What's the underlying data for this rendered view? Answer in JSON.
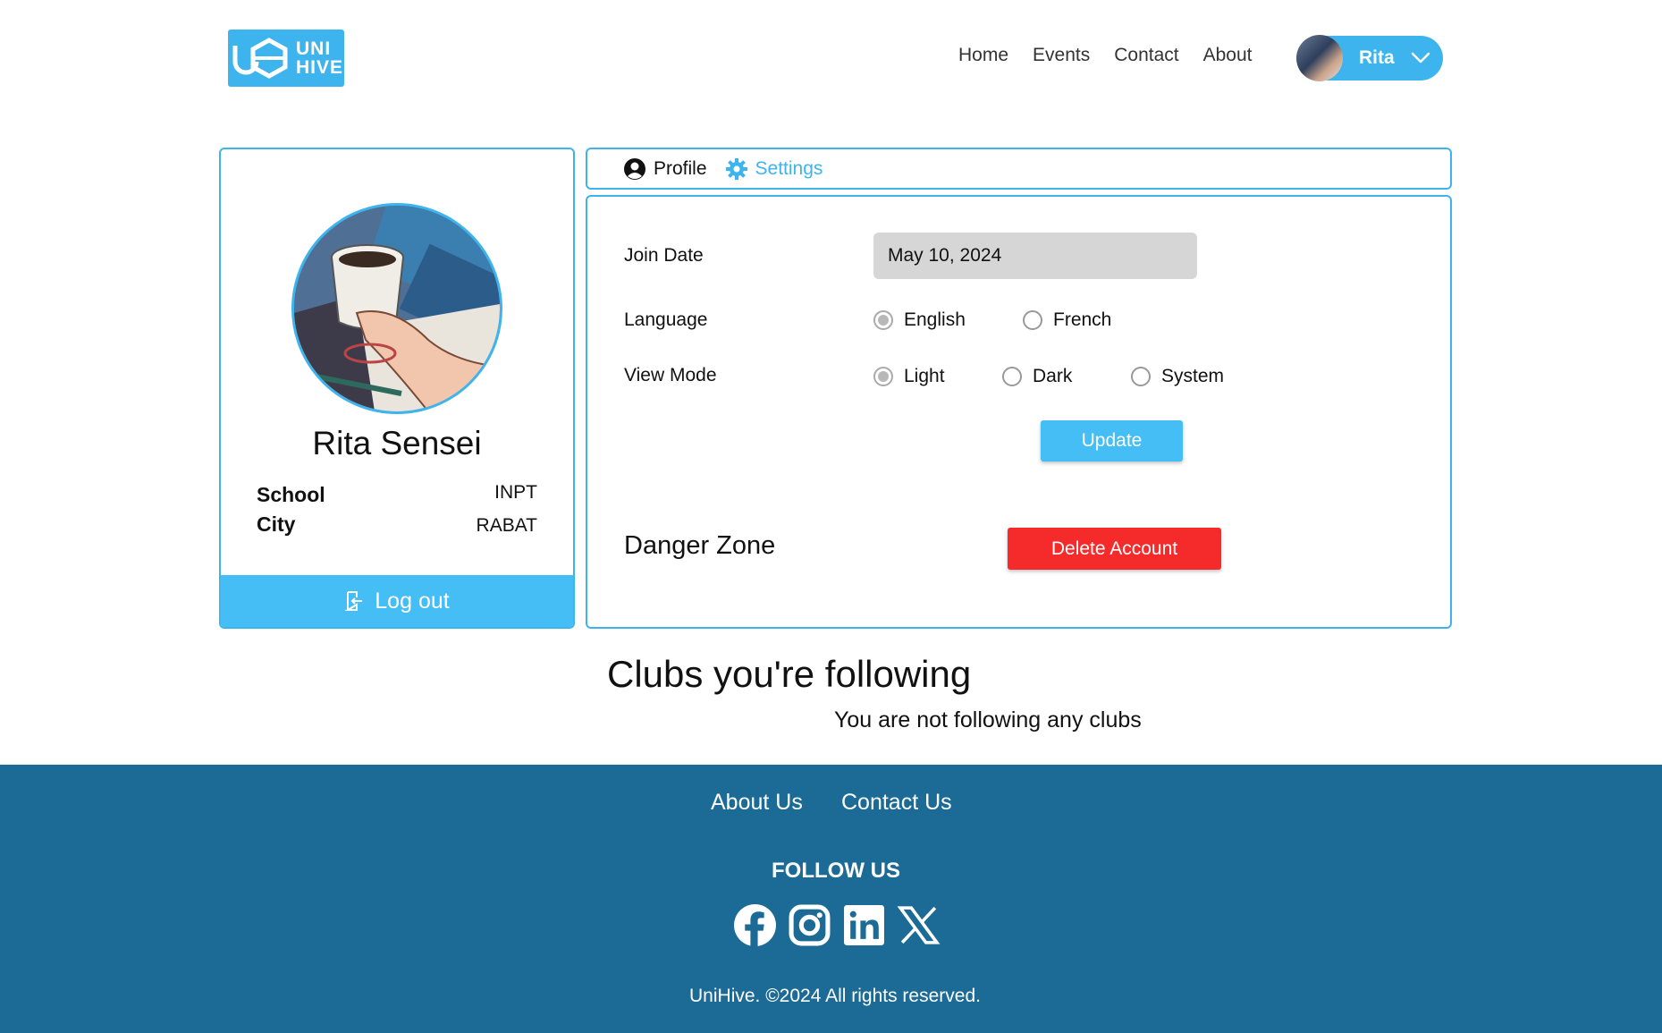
{
  "brand": {
    "logo_text_line1": "UNI",
    "logo_text_line2": "HIVE"
  },
  "nav": {
    "items": [
      "Home",
      "Events",
      "Contact",
      "About"
    ],
    "user_name": "Rita"
  },
  "profile": {
    "name": "Rita Sensei",
    "school_label": "School",
    "school_value": "INPT",
    "city_label": "City",
    "city_value": "RABAT",
    "logout_label": "Log out"
  },
  "tabs": {
    "profile": "Profile",
    "settings": "Settings",
    "active": "Settings"
  },
  "settings": {
    "join_date_label": "Join Date",
    "join_date_value": "May 10, 2024",
    "language_label": "Language",
    "language_options": [
      "English",
      "French"
    ],
    "language_selected": "English",
    "view_mode_label": "View Mode",
    "view_mode_options": [
      "Light",
      "Dark",
      "System"
    ],
    "view_mode_selected": "Light",
    "update_label": "Update",
    "danger_zone_title": "Danger Zone",
    "delete_label": "Delete Account"
  },
  "clubs": {
    "title": "Clubs you're following",
    "empty_message": "You are not following any clubs"
  },
  "footer": {
    "links": [
      "About Us",
      "Contact Us"
    ],
    "follow_title": "FOLLOW US",
    "social_icons": [
      "facebook-icon",
      "instagram-icon",
      "linkedin-icon",
      "x-icon"
    ],
    "copyright": "UniHive. ©2024 All rights reserved."
  },
  "colors": {
    "accent": "#3eb4ee",
    "button": "#45bdf5",
    "danger": "#f52a2a",
    "footer": "#1b6b96"
  }
}
